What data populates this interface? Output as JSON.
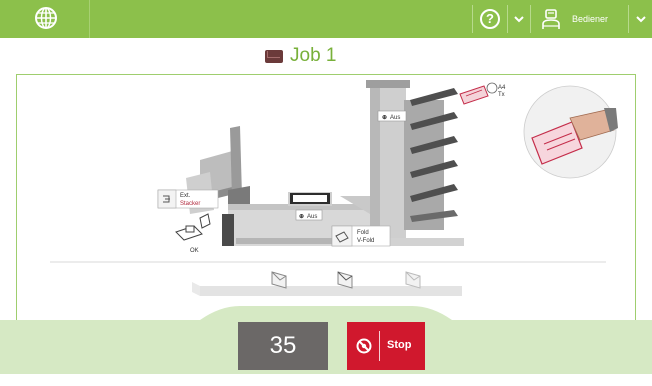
{
  "topbar": {
    "help_symbol": "?",
    "user_label": "Bediener",
    "colors": {
      "bar": "#8cc04b",
      "icon": "#ffffff"
    },
    "icons": [
      "globe-icon",
      "help-icon",
      "chevron-down-icon",
      "user-icon",
      "chevron-down-icon"
    ]
  },
  "job": {
    "title": "Job 1",
    "icon": "envelope-icon"
  },
  "machine": {
    "stacker_label_line1": "Ext.",
    "stacker_label_line2": "Stacker",
    "fold_label_line1": "Fold",
    "fold_label_line2": "V-Fold",
    "station_label": "Aus",
    "feeder_label": "Aus",
    "base_label": "Aus",
    "ok_label": "OK"
  },
  "controls": {
    "counter": "35",
    "stop_label": "Stop",
    "stop_color": "#d0182d"
  }
}
